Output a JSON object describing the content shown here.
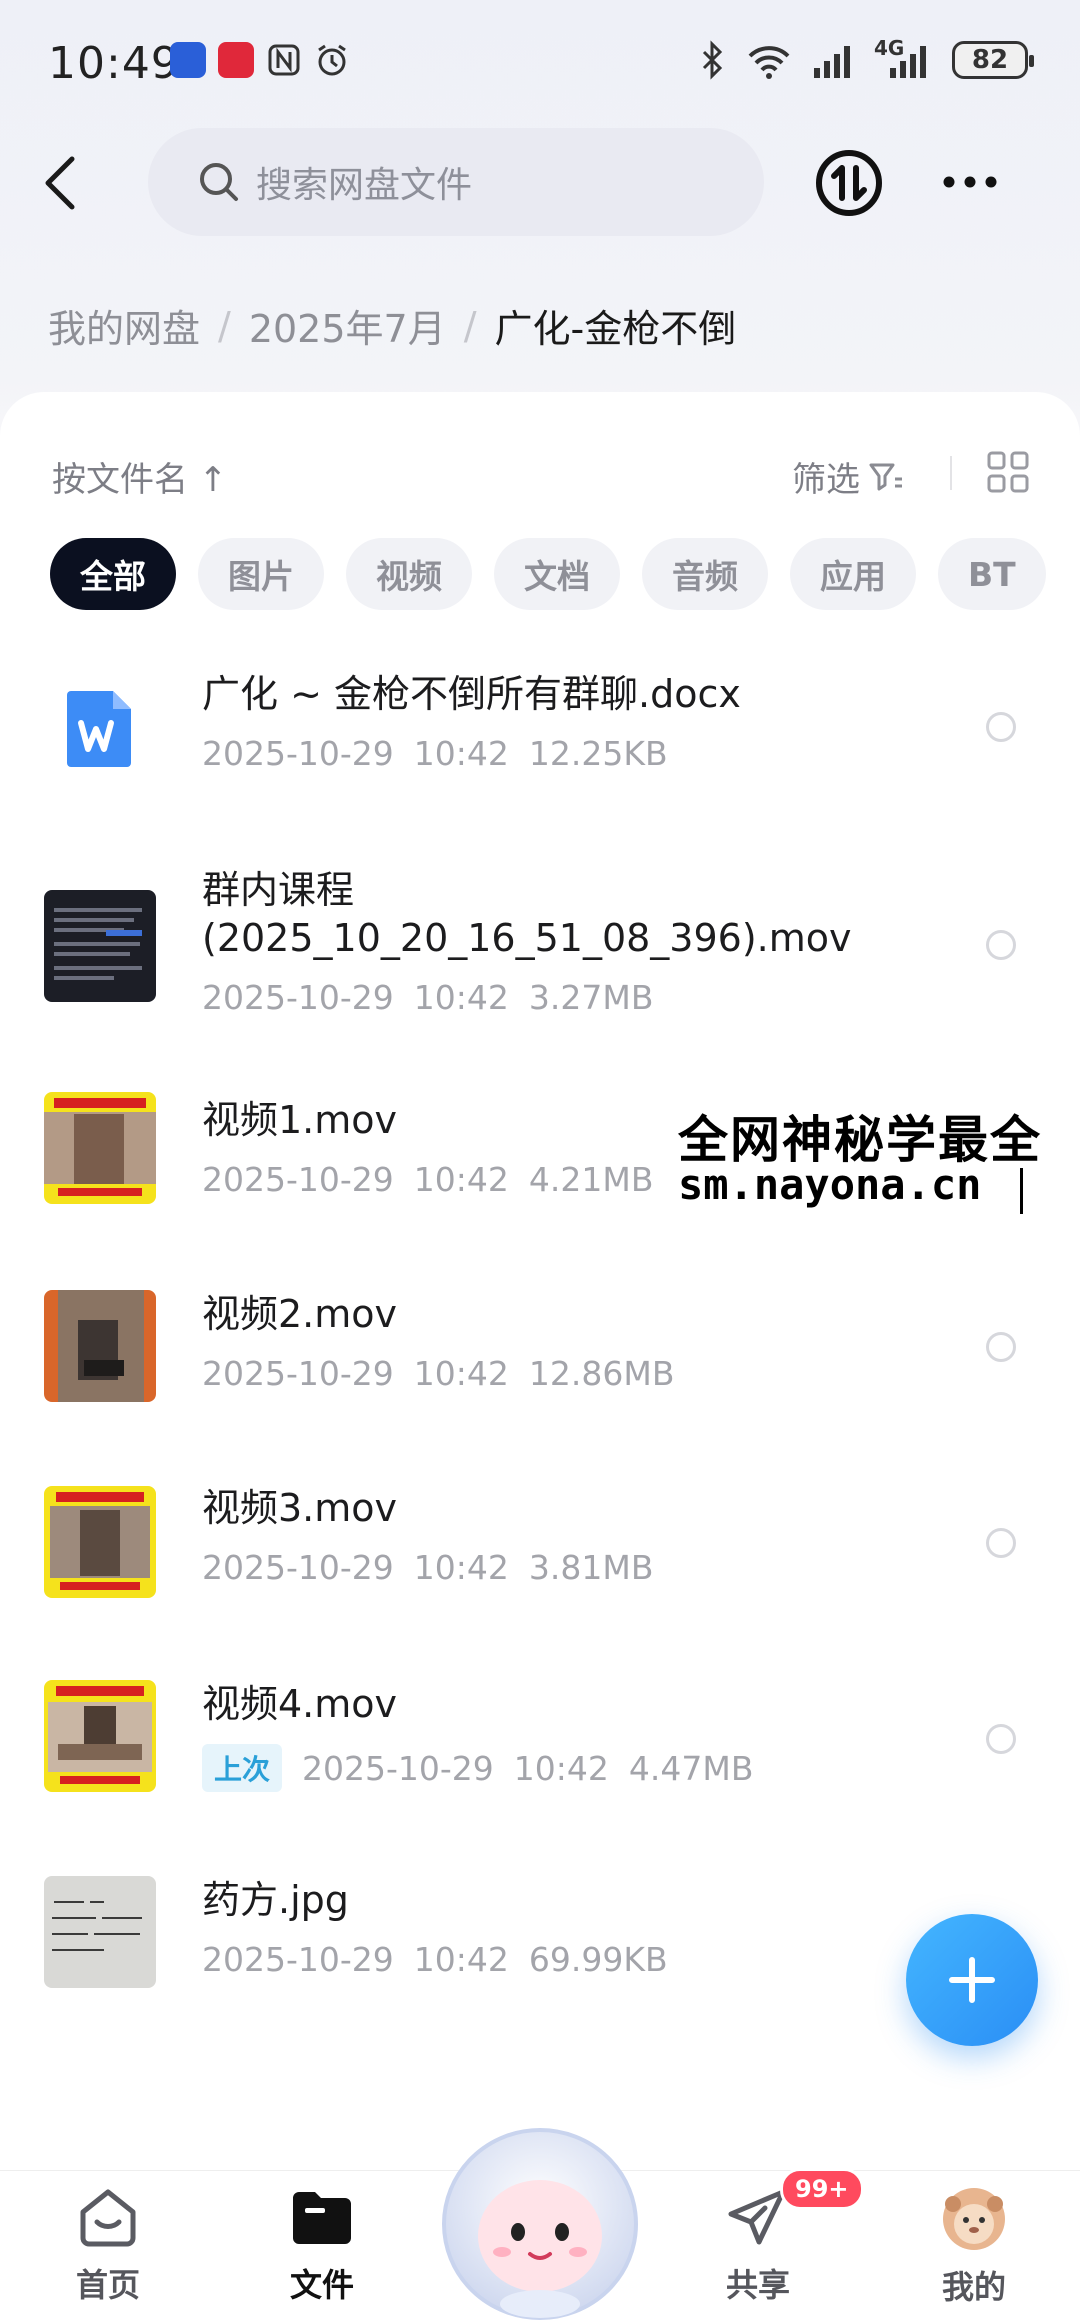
{
  "status_bar": {
    "time": "10:49",
    "battery": "82",
    "network": "4G"
  },
  "header": {
    "search_placeholder": "搜索网盘文件"
  },
  "breadcrumb": {
    "items": [
      "我的网盘",
      "2025年7月"
    ],
    "current": "广化-金枪不倒"
  },
  "toolbar": {
    "sort_label": "按文件名 ↑",
    "filter_label": "筛选"
  },
  "chips": [
    "全部",
    "图片",
    "视频",
    "文档",
    "音频",
    "应用",
    "BT"
  ],
  "files": [
    {
      "name": "广化 ~ 金枪不倒所有群聊.docx",
      "date": "2025-10-29",
      "time": "10:42",
      "size": "12.25KB"
    },
    {
      "name_line1": "群内课程",
      "name_line2": "(2025_10_20_16_51_08_396).mov",
      "date": "2025-10-29",
      "time": "10:42",
      "size": "3.27MB"
    },
    {
      "name": "视频1.mov",
      "date": "2025-10-29",
      "time": "10:42",
      "size": "4.21MB"
    },
    {
      "name": "视频2.mov",
      "date": "2025-10-29",
      "time": "10:42",
      "size": "12.86MB"
    },
    {
      "name": "视频3.mov",
      "date": "2025-10-29",
      "time": "10:42",
      "size": "3.81MB"
    },
    {
      "name": "视频4.mov",
      "badge": "上次",
      "date": "2025-10-29",
      "time": "10:42",
      "size": "4.47MB"
    },
    {
      "name": "药方.jpg",
      "date": "2025-10-29",
      "time": "10:42",
      "size": "69.99KB"
    }
  ],
  "watermark": {
    "line1": "全网神秘学最全",
    "line2": "sm.nayona.cn"
  },
  "bottom_nav": {
    "home": "首页",
    "files": "文件",
    "share": "共享",
    "share_badge": "99+",
    "mine": "我的"
  },
  "colors": {
    "accent": "#2a8ef5",
    "active_chip": "#0b1020"
  }
}
